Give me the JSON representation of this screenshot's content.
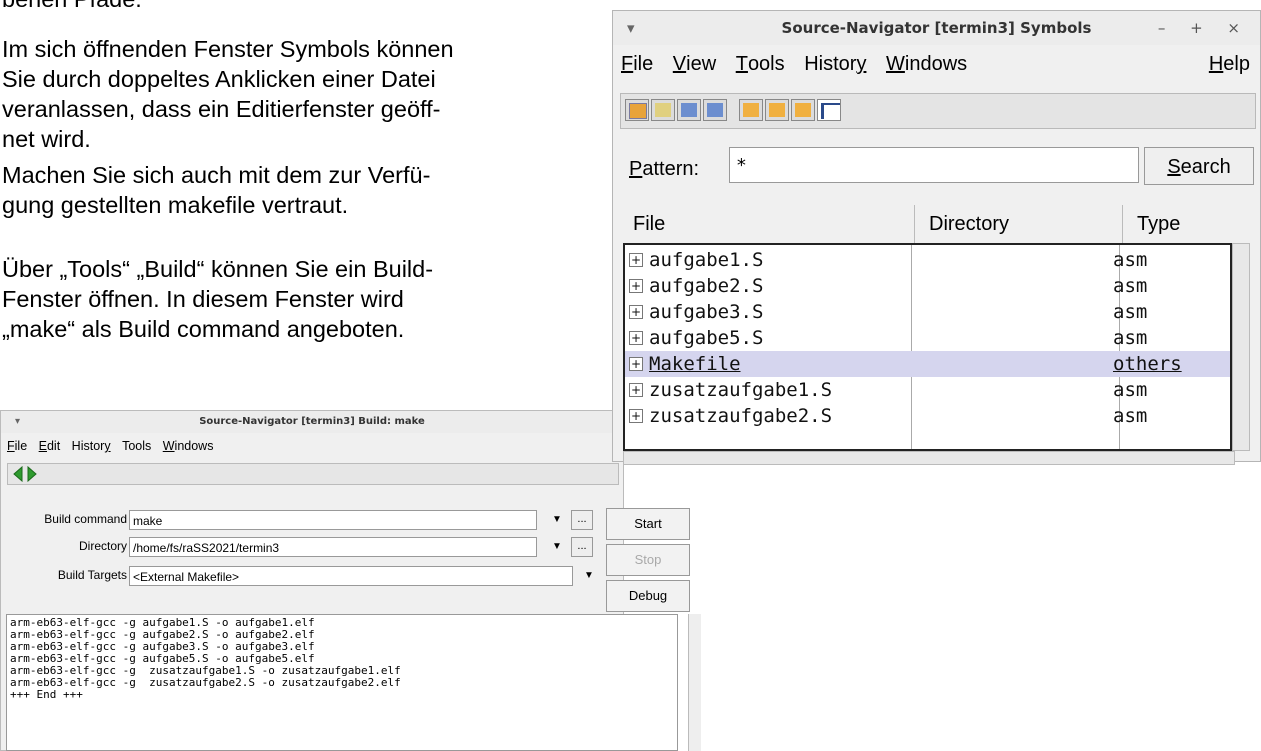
{
  "document": {
    "top_fragment": "benen Pfade.",
    "p1": "Im sich öffnenden Fenster Symbols können\nSie durch doppeltes Anklicken einer Datei\nveranlassen, dass ein Editierfenster geöff-\nnet wird.",
    "p2": "Machen Sie sich auch mit dem zur Verfü-\ngung gestellten makefile vertraut.",
    "p3": "Über „Tools“ „Build“ können Sie ein Build-\nFenster öffnen. In diesem Fenster wird\n„make“ als Build command angeboten."
  },
  "symbols_window": {
    "title": "Source-Navigator [termin3] Symbols",
    "window_buttons": "– + ×",
    "menu": {
      "file": "File",
      "view": "View",
      "tools": "Tools",
      "history": "History",
      "windows": "Windows",
      "help": "Help"
    },
    "pattern_label": "Pattern:",
    "pattern_value": "*",
    "search_label": "Search",
    "columns": {
      "file": "File",
      "directory": "Directory",
      "type": "Type"
    },
    "rows": [
      {
        "name": "aufgabe1.S",
        "directory": "",
        "type": "asm"
      },
      {
        "name": "aufgabe2.S",
        "directory": "",
        "type": "asm"
      },
      {
        "name": "aufgabe3.S",
        "directory": "",
        "type": "asm"
      },
      {
        "name": "aufgabe5.S",
        "directory": "",
        "type": "asm"
      },
      {
        "name": "Makefile",
        "directory": "",
        "type": "others",
        "selected": true
      },
      {
        "name": "zusatzaufgabe1.S",
        "directory": "",
        "type": "asm"
      },
      {
        "name": "zusatzaufgabe2.S",
        "directory": "",
        "type": "asm"
      }
    ],
    "plus_glyph": "+"
  },
  "build_window": {
    "title": "Source-Navigator [termin3] Build: make",
    "menu": {
      "file": "File",
      "edit": "Edit",
      "history": "History",
      "tools": "Tools",
      "windows": "Windows"
    },
    "build_command_label": "Build command",
    "build_command_value": "make",
    "directory_label": "Directory",
    "directory_value": "/home/fs/raSS2021/termin3",
    "build_targets_label": "Build Targets",
    "build_targets_value": "<External Makefile>",
    "dots": "...",
    "start_label": "Start",
    "stop_label": "Stop",
    "debug_label": "Debug",
    "output": "arm-eb63-elf-gcc -g aufgabe1.S -o aufgabe1.elf\narm-eb63-elf-gcc -g aufgabe2.S -o aufgabe2.elf\narm-eb63-elf-gcc -g aufgabe3.S -o aufgabe3.elf\narm-eb63-elf-gcc -g aufgabe5.S -o aufgabe5.elf\narm-eb63-elf-gcc -g  zusatzaufgabe1.S -o zusatzaufgabe1.elf\narm-eb63-elf-gcc -g  zusatzaufgabe2.S -o zusatzaufgabe2.elf\n+++ End +++"
  },
  "colors": {
    "selection": "#d5d5ee",
    "back_arrow": "#2e9a2e",
    "forward_arrow": "#2e9a2e",
    "stop_disabled": "#a9a9a9"
  },
  "icons": {
    "window_menu": "chevron-down-icon",
    "dropdown": "triangle-down-icon",
    "back": "back-arrow-icon",
    "forward": "forward-arrow-icon"
  }
}
